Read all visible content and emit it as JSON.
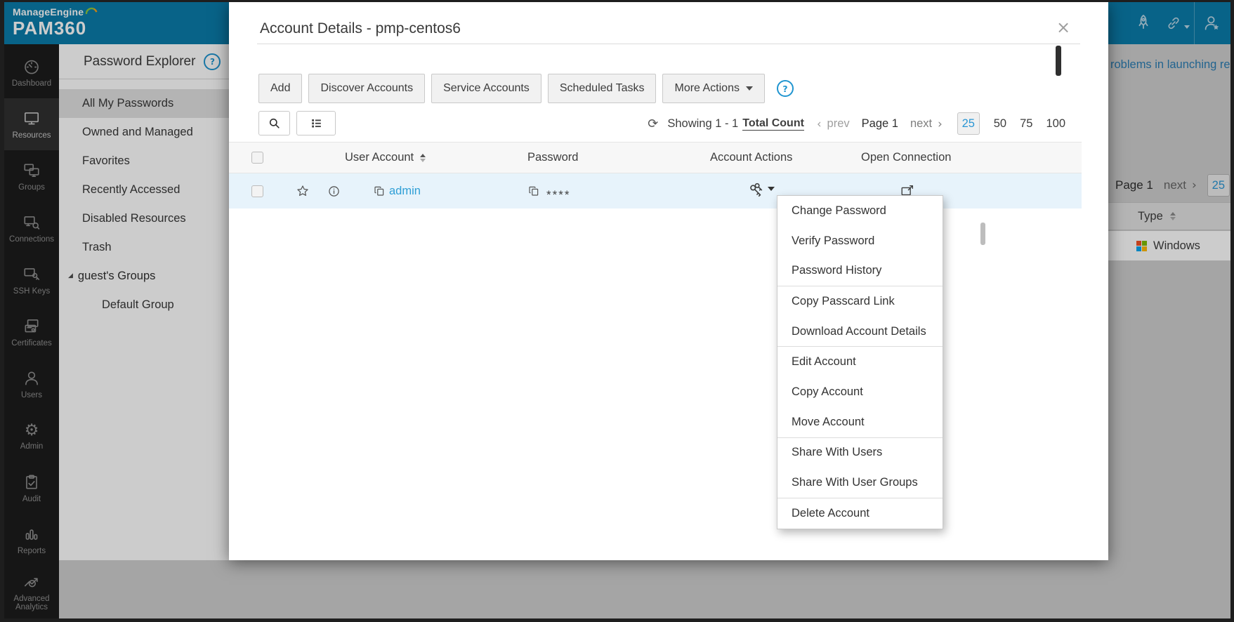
{
  "colors": {
    "topbar_teal": "#0b7cab",
    "accent_blue": "#2095d0",
    "link_blue": "#2f9fd6",
    "row_selected": "#e7f3fb",
    "menu_text": "#333333"
  },
  "brand": {
    "name": "ManageEngine",
    "product": "PAM360"
  },
  "sidebar": {
    "items": [
      {
        "label": "Dashboard"
      },
      {
        "label": "Resources"
      },
      {
        "label": "Groups"
      },
      {
        "label": "Connections"
      },
      {
        "label": "SSH Keys"
      },
      {
        "label": "Certificates"
      },
      {
        "label": "Users"
      },
      {
        "label": "Admin"
      },
      {
        "label": "Audit"
      },
      {
        "label": "Reports"
      },
      {
        "label": "Advanced Analytics"
      }
    ]
  },
  "explorer": {
    "title": "Password Explorer",
    "items": [
      {
        "label": "All My Passwords"
      },
      {
        "label": "Owned and Managed"
      },
      {
        "label": "Favorites"
      },
      {
        "label": "Recently Accessed"
      },
      {
        "label": "Disabled Resources"
      },
      {
        "label": "Trash"
      }
    ],
    "tree": {
      "group": "guest's Groups",
      "child": "Default Group"
    }
  },
  "background": {
    "notification": "roblems in launching re",
    "pagination": {
      "page": "Page 1",
      "next": "next",
      "size": "25"
    },
    "table": {
      "header": "Type",
      "row_os": "Windows"
    }
  },
  "modal": {
    "title": "Account Details - pmp-centos6",
    "toolbar": {
      "buttons": [
        "Add",
        "Discover Accounts",
        "Service Accounts",
        "Scheduled Tasks",
        "More Actions"
      ]
    },
    "pagination": {
      "showing": "Showing 1 - 1",
      "total_count": "Total Count",
      "prev": "prev",
      "page": "Page 1",
      "next": "next",
      "sizes": [
        "25",
        "50",
        "75",
        "100"
      ]
    },
    "table": {
      "headers": [
        "User Account",
        "Password",
        "Account Actions",
        "Open Connection"
      ],
      "row": {
        "user": "admin",
        "password_mask": "****"
      }
    },
    "menu": {
      "groups": [
        [
          "Change Password",
          "Verify Password",
          "Password History"
        ],
        [
          "Copy Passcard Link",
          "Download Account Details"
        ],
        [
          "Edit Account",
          "Copy Account",
          "Move Account"
        ],
        [
          "Share With Users",
          "Share With User Groups"
        ],
        [
          "Delete Account"
        ]
      ]
    }
  },
  "icons": {
    "close": "×",
    "help": "?",
    "chevron_left": "‹",
    "chevron_right": "›",
    "refresh": "⟳",
    "tree_expanded": "◢"
  }
}
